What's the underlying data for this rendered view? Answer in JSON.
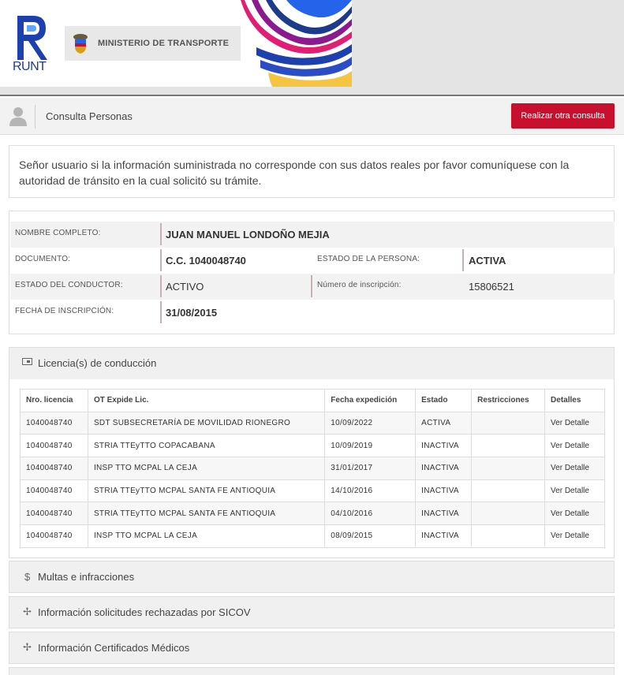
{
  "header": {
    "runt_logo_text": "RUNT",
    "ministry_text": "MINISTERIO DE TRANSPORTE"
  },
  "titlebar": {
    "title": "Consulta Personas",
    "button_label": "Realizar otra consulta",
    "button_color": "#c8102e"
  },
  "notice": {
    "text": "Señor usuario si la información suministrada no corresponde con sus datos reales por favor comuníquese con la autoridad de tránsito en la cual solicitó su trámite."
  },
  "person": {
    "nombre_label": "NOMBRE COMPLETO:",
    "nombre_value": "JUAN MANUEL LONDOÑO MEJIA",
    "documento_label": "DOCUMENTO:",
    "documento_value": "C.C. 1040048740",
    "estado_persona_label": "ESTADO DE LA PERSONA:",
    "estado_persona_value": "ACTIVA",
    "estado_conductor_label": "ESTADO DEL CONDUCTOR:",
    "estado_conductor_value": "ACTIVO",
    "inscripcion_label": "Número de inscripción:",
    "inscripcion_value": "15806521",
    "fecha_label": "FECHA DE INSCRIPCIÓN:",
    "fecha_value": "31/08/2015"
  },
  "licencias": {
    "title": "Licencia(s) de conducción",
    "icon": "id-card-icon",
    "columns": [
      "Nro. licencia",
      "OT Expide Lic.",
      "Fecha expedición",
      "Estado",
      "Restricciones",
      "Detalles"
    ],
    "rows": [
      [
        "1040048740",
        "SDT SUBSECRETARÍA DE MOVILIDAD RIONEGRO",
        "10/09/2022",
        "ACTIVA",
        "",
        "Ver Detalle"
      ],
      [
        "1040048740",
        "STRIA TTEyTTO COPACABANA",
        "10/09/2019",
        "INACTIVA",
        "",
        "Ver Detalle"
      ],
      [
        "1040048740",
        "INSP TTO MCPAL LA CEJA",
        "31/01/2017",
        "INACTIVA",
        "",
        "Ver Detalle"
      ],
      [
        "1040048740",
        "STRIA TTEyTTO MCPAL SANTA FE ANTIOQUIA",
        "14/10/2016",
        "INACTIVA",
        "",
        "Ver Detalle"
      ],
      [
        "1040048740",
        "STRIA TTEyTTO MCPAL SANTA FE ANTIOQUIA",
        "04/10/2016",
        "INACTIVA",
        "",
        "Ver Detalle"
      ],
      [
        "1040048740",
        "INSP TTO MCPAL LA CEJA",
        "08/09/2015",
        "INACTIVA",
        "",
        "Ver Detalle"
      ]
    ]
  },
  "sections": [
    {
      "icon_glyph": "$",
      "icon": "dollar-icon",
      "title": "Multas e infracciones"
    },
    {
      "icon_glyph": "✢",
      "icon": "plus-icon",
      "title": "Información solicitudes rechazadas por SICOV"
    },
    {
      "icon_glyph": "✢",
      "icon": "plus-icon",
      "title": "Información Certificados Médicos"
    }
  ]
}
